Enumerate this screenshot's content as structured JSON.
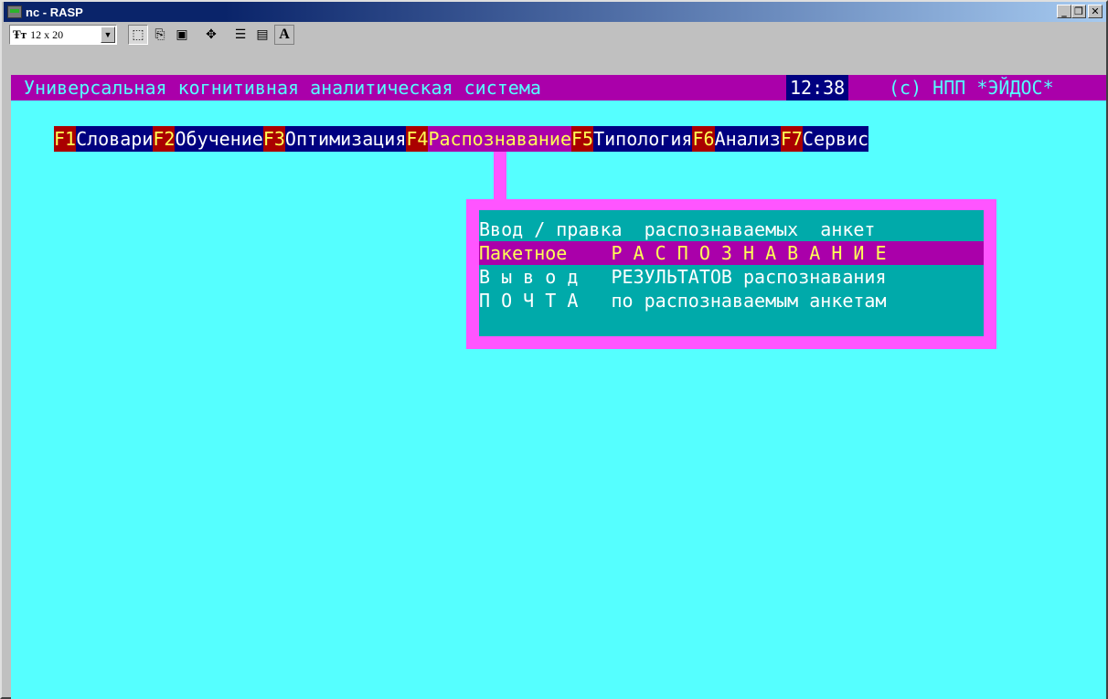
{
  "window": {
    "title": "nc - RASP",
    "buttons": [
      "_",
      "❐",
      "✕"
    ]
  },
  "toolbar": {
    "font_size": "12 x 20",
    "font_icon": "Ŧт",
    "tools": [
      {
        "name": "select-icon",
        "glyph": "⬚"
      },
      {
        "name": "copy-icon",
        "glyph": "⎘"
      },
      {
        "name": "paste-icon",
        "glyph": "📋"
      },
      {
        "name": "fullscreen-icon",
        "glyph": "✥"
      },
      {
        "name": "properties-icon",
        "glyph": "☰"
      },
      {
        "name": "background-icon",
        "glyph": "▤"
      },
      {
        "name": "font-icon",
        "glyph": "A"
      }
    ]
  },
  "status": {
    "title": "Универсальная когнитивная аналитическая система",
    "time": "12:38",
    "copyright": "(с) НПП *ЭЙДОС*"
  },
  "menu": [
    {
      "key": "F1",
      "label": "Словари",
      "active": false
    },
    {
      "key": "F2",
      "label": "Обучение",
      "active": false
    },
    {
      "key": "F3",
      "label": "Оптимизация",
      "active": false
    },
    {
      "key": "F4",
      "label": "Распознавание",
      "active": true
    },
    {
      "key": "F5",
      "label": "Типология",
      "active": false
    },
    {
      "key": "F6",
      "label": "Анализ",
      "active": false
    },
    {
      "key": "F7",
      "label": "Сервис",
      "active": false
    }
  ],
  "submenu": [
    {
      "label": "Ввод / правка  распознаваемых  анкет",
      "selected": false
    },
    {
      "label": "Пакетное    Р А С П О З Н А В А Н И Е",
      "selected": true
    },
    {
      "label": "В ы в о д   РЕЗУЛЬТАТОВ распознавания",
      "selected": false
    },
    {
      "label": "П О Ч Т А   по распознаваемым анкетам",
      "selected": false
    }
  ],
  "colors": {
    "console_bg": "#55ffff",
    "status_bg": "#aa00aa",
    "menu_key_bg": "#aa0000",
    "menu_label_bg": "#000080",
    "dropdown_border": "#ff55ff",
    "dropdown_bg": "#00aaaa"
  }
}
